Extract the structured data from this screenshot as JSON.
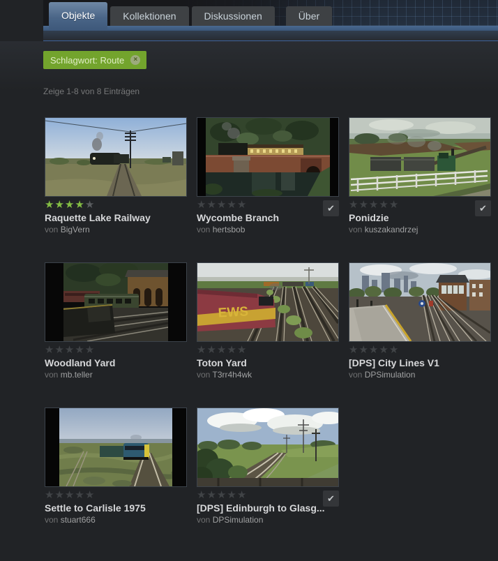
{
  "header": {
    "tabs": [
      {
        "label": "Objekte",
        "active": true
      },
      {
        "label": "Kollektionen",
        "active": false
      },
      {
        "label": "Diskussionen",
        "active": false
      },
      {
        "label": "Über",
        "active": false
      }
    ]
  },
  "filter": {
    "tag_label": "Schlagwort: Route"
  },
  "results_summary": "Zeige 1-8 von 8 Einträgen",
  "labels": {
    "by": "von"
  },
  "icons": {
    "star": "★",
    "check": "✔",
    "close": "×"
  },
  "colors": {
    "accent_green": "#73a42d",
    "star_green": "#84bd44",
    "tab_active_blue": "#4a6587",
    "tab_underline_blue": "#3e5c80",
    "page_background": "#212326"
  },
  "items": [
    {
      "title": "Raquette Lake Railway",
      "author": "BigVern",
      "rating": 4,
      "subscribed": false
    },
    {
      "title": "Wycombe Branch",
      "author": "hertsbob",
      "rating": 0,
      "subscribed": true
    },
    {
      "title": "Ponidzie",
      "author": "kuszakandrzej",
      "rating": 0,
      "subscribed": true
    },
    {
      "title": "Woodland Yard",
      "author": "mb.teller",
      "rating": 0,
      "subscribed": false
    },
    {
      "title": "Toton Yard",
      "author": "T3rr4h4wk",
      "rating": 0,
      "subscribed": false,
      "thumb_text": "EWS"
    },
    {
      "title": "[DPS] City Lines V1",
      "author": "DPSimulation",
      "rating": 0,
      "subscribed": false
    },
    {
      "title": "Settle to Carlisle 1975",
      "author": "stuart666",
      "rating": 0,
      "subscribed": false
    },
    {
      "title": "[DPS] Edinburgh to Glasg...",
      "author": "DPSimulation",
      "rating": 0,
      "subscribed": true
    }
  ]
}
